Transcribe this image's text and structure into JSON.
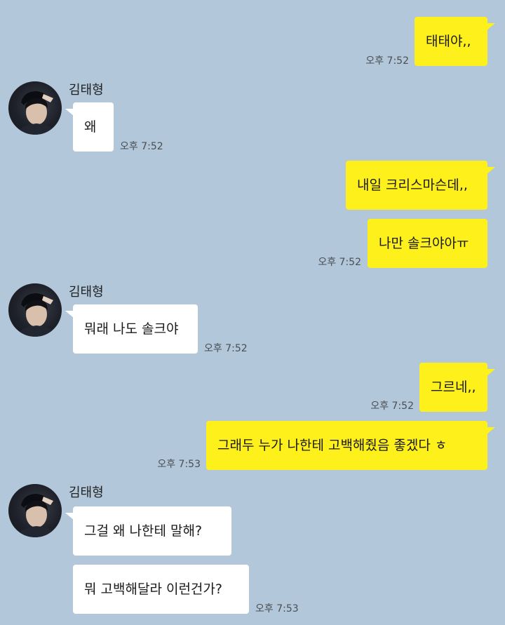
{
  "colors": {
    "background": "#b2c7d9",
    "my_bubble": "#fef01b",
    "their_bubble": "#ffffff"
  },
  "messages": [
    {
      "side": "mine",
      "text": "태태야,,",
      "time": "오후 7:52"
    },
    {
      "side": "theirs",
      "sender": "김태형",
      "text": "왜",
      "time": "오후 7:52"
    },
    {
      "side": "mine",
      "text": "내일 크리스마슨데,,",
      "time": ""
    },
    {
      "side": "mine",
      "text": "나만 솔크야아ㅠ",
      "time": "오후 7:52"
    },
    {
      "side": "theirs",
      "sender": "김태형",
      "text": "뭐래 나도 솔크야",
      "time": "오후 7:52"
    },
    {
      "side": "mine",
      "text": "그르네,,",
      "time": "오후 7:52"
    },
    {
      "side": "mine",
      "text": "그래두 누가 나한테 고백해줬음 좋겠다 ㅎ",
      "time": "오후 7:53"
    },
    {
      "side": "theirs",
      "sender": "김태형",
      "text": "그걸 왜 나한테 말해?",
      "time": ""
    },
    {
      "side": "theirs",
      "sender": "",
      "text": "뭐 고백해달라 이런건가?",
      "time": "오후 7:53"
    }
  ]
}
